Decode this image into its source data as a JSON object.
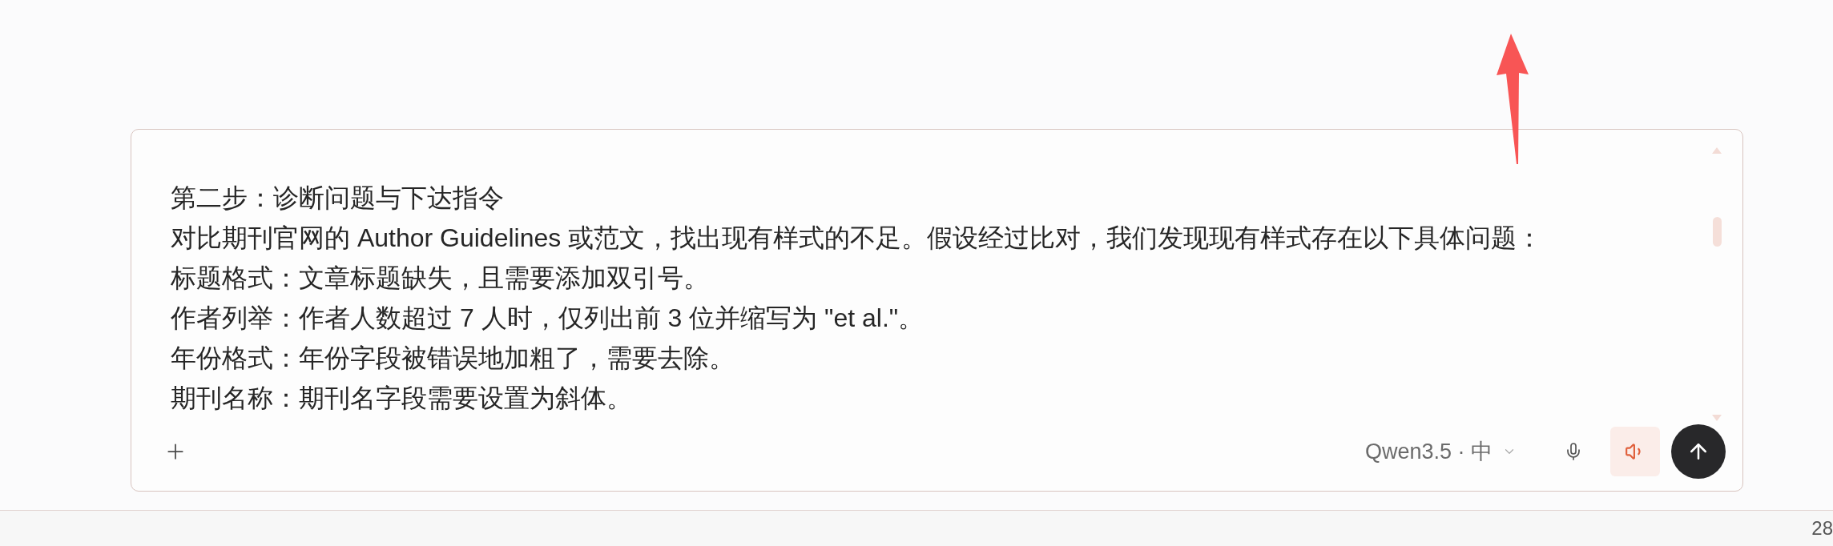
{
  "composer": {
    "message_lines": [
      "第二步：诊断问题与下达指令",
      "对比期刊官网的 Author Guidelines 或范文，找出现有样式的不足。假设经过比对，我们发现现有样式存在以下具体问题：",
      "标题格式：文章标题缺失，且需要添加双引号。",
      "作者列举：作者人数超过 7 人时，仅列出前 3 位并缩写为 \"et al.\"。",
      "年份格式：年份字段被错误地加粗了，需要去除。",
      "期刊名称：期刊名字段需要设置为斜体。"
    ],
    "model_selector": {
      "label": "Qwen3.5 · 中"
    },
    "voice_output": {
      "on": true
    }
  },
  "status_bar": {
    "text": "28"
  }
}
